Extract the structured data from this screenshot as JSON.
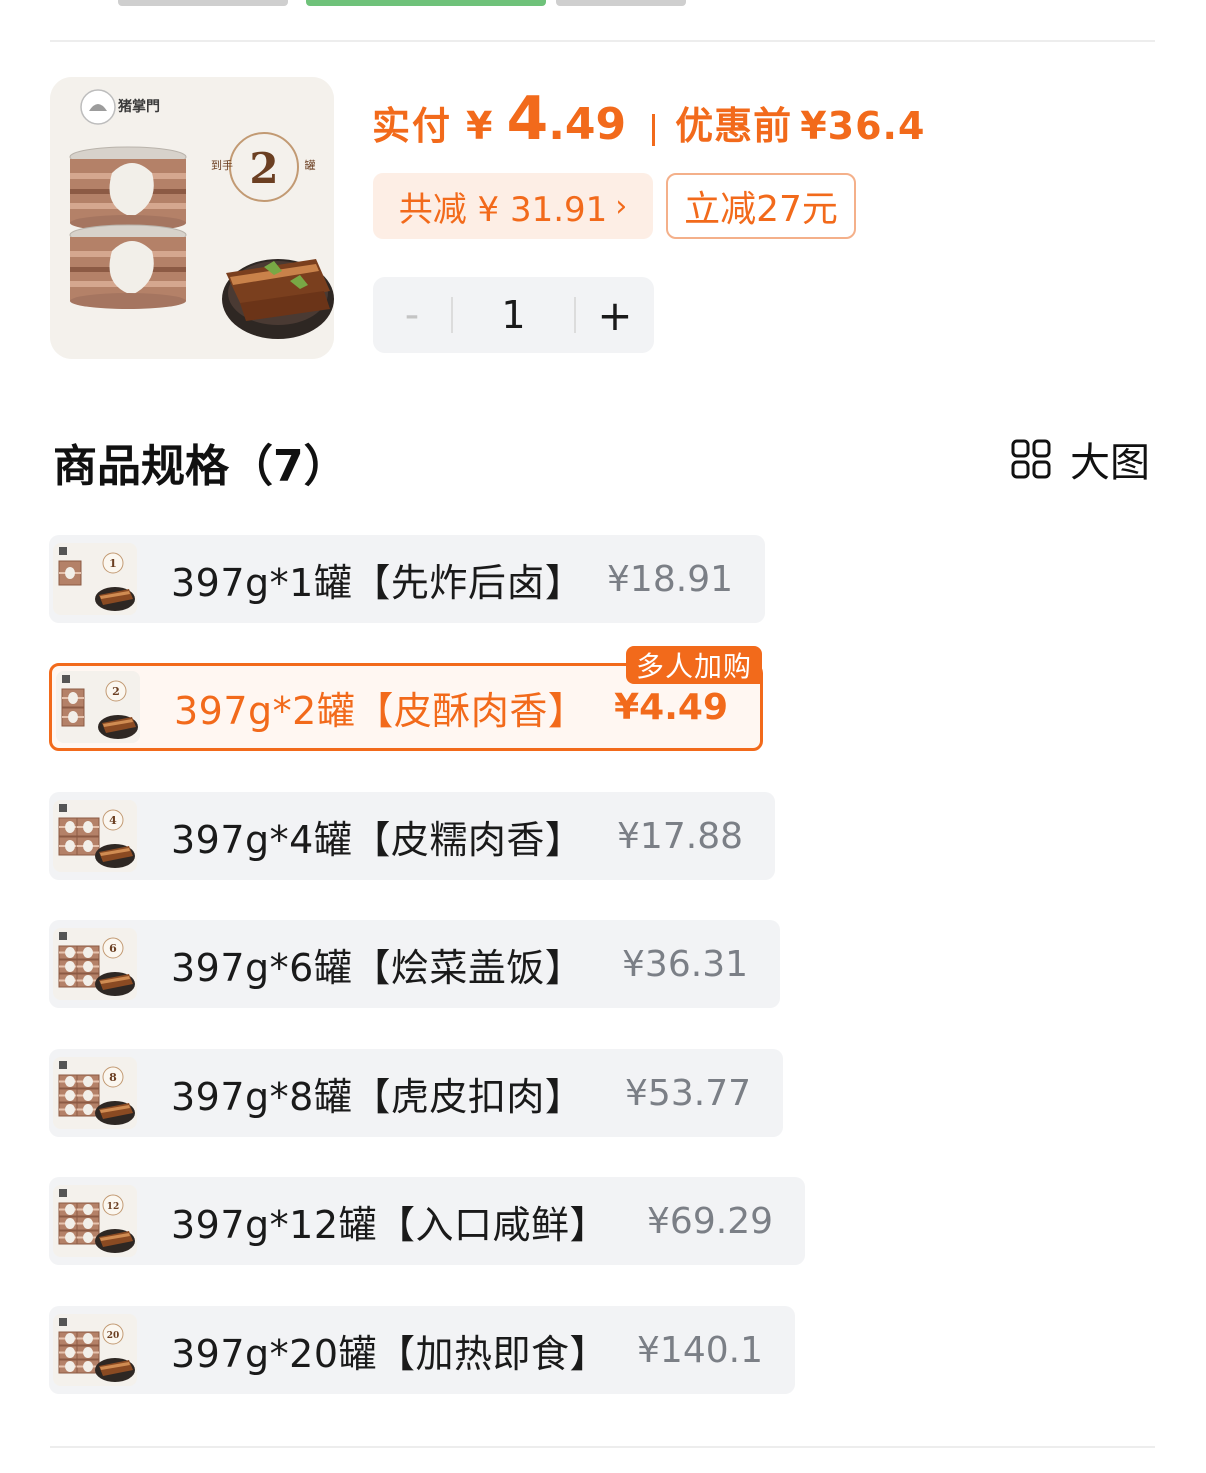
{
  "colors": {
    "accent": "#f26a1b",
    "accent_soft": "#fdeee5",
    "chip_bg": "#f2f3f5",
    "muted_price": "#7b7f86"
  },
  "product": {
    "image_icon": "canned-pork-product-image",
    "logo_text": "猪掌門",
    "image_badge_left": "到手",
    "image_badge_number": "2",
    "image_badge_right": "罐"
  },
  "price": {
    "label": "实付",
    "currency": "¥",
    "integer": "4",
    "decimal": ".49",
    "original_label": "优惠前",
    "original_value": "¥36.4"
  },
  "tags": {
    "saving": "共减 ¥ 31.91",
    "saving_chevron": "›",
    "coupon": "立减27元"
  },
  "stepper": {
    "minus": "-",
    "quantity": "1",
    "plus": "+"
  },
  "section": {
    "title": "商品规格（7）",
    "big_view_label": "大图",
    "big_view_icon": "grid-view-icon"
  },
  "specs": [
    {
      "name": "397g*1罐【先炸后卤】",
      "price": "¥18.91",
      "cans": "1",
      "selected": false
    },
    {
      "name": "397g*2罐【皮酥肉香】",
      "price": "¥4.49",
      "cans": "2",
      "selected": true,
      "badge": "多人加购"
    },
    {
      "name": "397g*4罐【皮糯肉香】",
      "price": "¥17.88",
      "cans": "4",
      "selected": false
    },
    {
      "name": "397g*6罐【烩菜盖饭】",
      "price": "¥36.31",
      "cans": "6",
      "selected": false
    },
    {
      "name": "397g*8罐【虎皮扣肉】",
      "price": "¥53.77",
      "cans": "8",
      "selected": false
    },
    {
      "name": "397g*12罐【入口咸鲜】",
      "price": "¥69.29",
      "cans": "12",
      "selected": false
    },
    {
      "name": "397g*20罐【加热即食】",
      "price": "¥140.1",
      "cans": "20",
      "selected": false
    }
  ]
}
